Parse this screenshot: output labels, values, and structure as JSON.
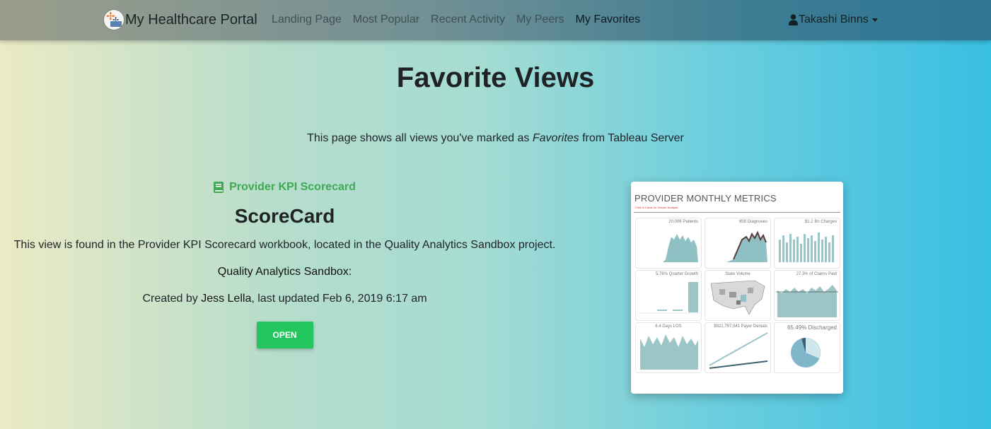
{
  "navbar": {
    "brand": "My Healthcare Portal",
    "links": [
      {
        "label": "Landing Page"
      },
      {
        "label": "Most Popular"
      },
      {
        "label": "Recent Activity"
      },
      {
        "label": "My Peers"
      },
      {
        "label": "My Favorites",
        "active": true
      }
    ],
    "user": "Takashi Binns"
  },
  "page": {
    "title": "Favorite Views",
    "subtitle_pre": "This page shows all views you've marked as ",
    "subtitle_em": "Favorites",
    "subtitle_post": " from Tableau Server"
  },
  "view": {
    "workbook": "Provider KPI Scorecard",
    "name": "ScoreCard",
    "description": "This view is found in the Provider KPI Scorecard workbook, located in the Quality Analytics Sandbox project.",
    "project": "Quality Analytics Sandbox",
    "project_suffix": ":",
    "created_pre": "Created by ",
    "author": "Jess Lella",
    "created_post": ", last updated Feb 6, 2019 6:17 am",
    "open_label": "OPEN"
  },
  "thumbnail": {
    "title": "PROVIDER MONTHLY METRICS",
    "subtitle": "Click in Cards for Deeper Analysis",
    "tiles": [
      {
        "label": "20,006 Patients"
      },
      {
        "label": "656 Diagnoses"
      },
      {
        "label": "$1.2 Bn Charges"
      },
      {
        "label": "5.78% Quarter Growth"
      },
      {
        "label": "State Volume"
      },
      {
        "label": "27.3% of Claims Paid"
      },
      {
        "label": "6.4 Days LOS"
      },
      {
        "label": "$921,797,041 Payer Denials"
      },
      {
        "label": "65.49% Discharged"
      }
    ]
  },
  "colors": {
    "accent_green": "#3fa953",
    "button_green": "#22c55e"
  }
}
